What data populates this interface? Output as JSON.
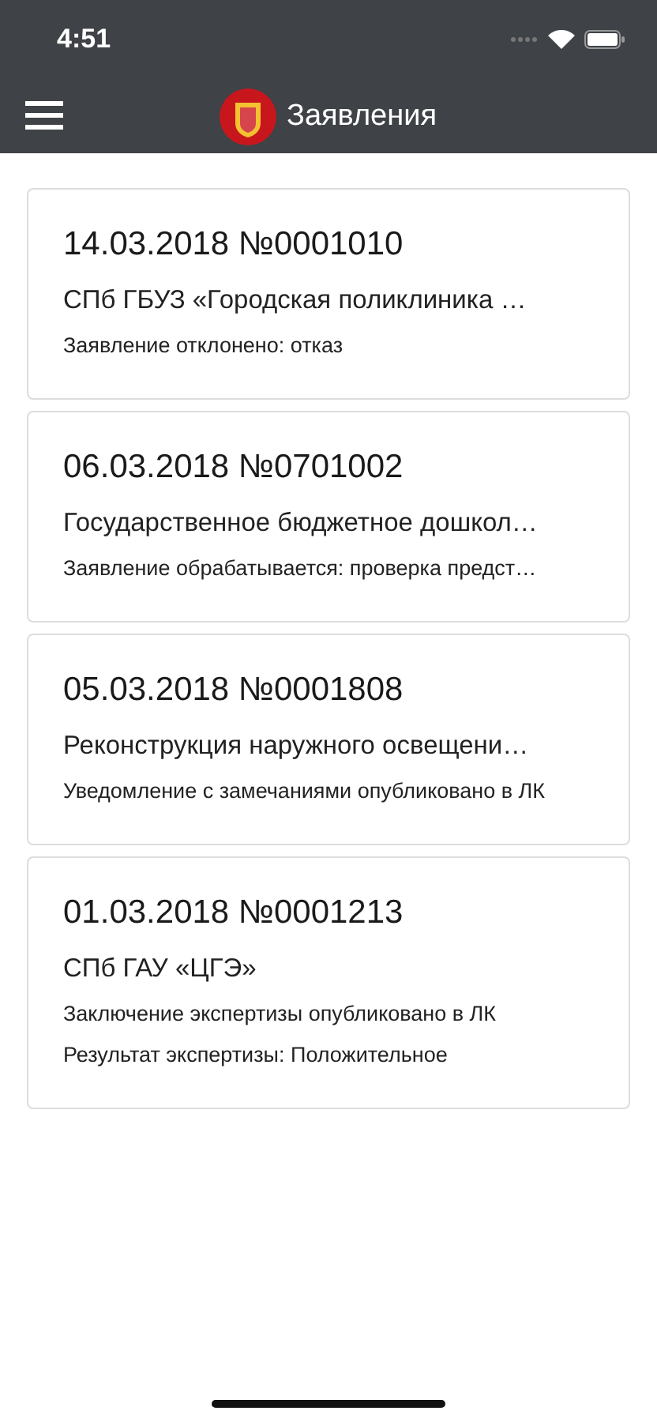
{
  "status_bar": {
    "time": "4:51"
  },
  "header": {
    "title": "Заявления"
  },
  "applications": [
    {
      "title": "14.03.2018 №0001010",
      "organization": "СПб ГБУЗ «Городская поликлиника …",
      "statuses": [
        "Заявление отклонено: отказ"
      ]
    },
    {
      "title": "06.03.2018 №0701002",
      "organization": "Государственное бюджетное дошкол…",
      "statuses": [
        "Заявление обрабатывается: проверка предст…"
      ]
    },
    {
      "title": "05.03.2018 №0001808",
      "organization": "Реконструкция наружного освещени…",
      "statuses": [
        "Уведомление с замечаниями опубликовано в ЛК"
      ]
    },
    {
      "title": "01.03.2018 №0001213",
      "organization": "СПб ГАУ «ЦГЭ»",
      "statuses": [
        "Заключение экспертизы опубликовано в ЛК",
        "Результат экспертизы: Положительное"
      ]
    }
  ]
}
